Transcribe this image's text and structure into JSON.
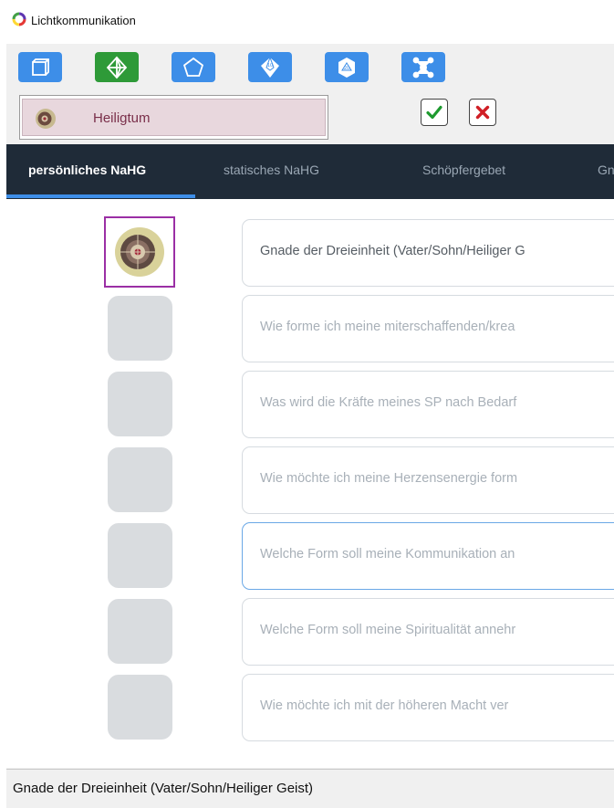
{
  "window": {
    "title": "Lichtkommunikation"
  },
  "toolbar": {
    "buttons": [
      {
        "icon": "cube-icon",
        "active": false
      },
      {
        "icon": "octahedron-icon",
        "active": true
      },
      {
        "icon": "pentagon-icon",
        "active": false
      },
      {
        "icon": "d10-die-icon",
        "active": false
      },
      {
        "icon": "d20-die-icon",
        "active": false
      },
      {
        "icon": "network-icon",
        "active": false
      }
    ]
  },
  "selection": {
    "label": "Heiligtum",
    "confirm_icon": "check-icon",
    "cancel_icon": "close-icon"
  },
  "tabs": [
    {
      "label": "persönliches NaHG",
      "active": true
    },
    {
      "label": "statisches NaHG",
      "active": false
    },
    {
      "label": "Schöpfergebet",
      "active": false
    },
    {
      "label": "Gna",
      "active": false
    }
  ],
  "rows": [
    {
      "text": "Gnade der Dreieinheit (Vater/Sohn/Heiliger G",
      "filled": true
    },
    {
      "text": "Wie forme ich meine miterschaffenden/krea",
      "filled": false
    },
    {
      "text": "Was wird die Kräfte meines SP nach Bedarf",
      "filled": false
    },
    {
      "text": "Wie möchte ich meine Herzensenergie form",
      "filled": false
    },
    {
      "text": "Welche Form soll meine Kommunikation an",
      "filled": false,
      "focused": true
    },
    {
      "text": "Welche Form soll meine Spiritualität annehr",
      "filled": false
    },
    {
      "text": "Wie möchte ich mit der höheren Macht ver",
      "filled": false
    }
  ],
  "status": {
    "text": "Gnade der Dreieinheit (Vater/Sohn/Heiliger Geist)"
  },
  "colors": {
    "accent_blue": "#3d8ee8",
    "active_green": "#2e9a38",
    "tabbar_bg": "#1f2b38",
    "selection_bg": "#e8d7dd",
    "selected_slot_border": "#9b2fa5"
  }
}
